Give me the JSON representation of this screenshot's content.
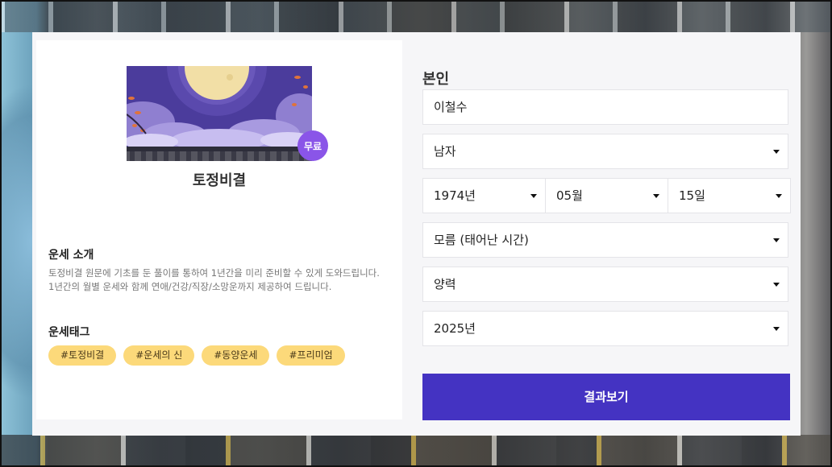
{
  "product": {
    "free_badge": "무료",
    "title": "토정비결"
  },
  "intro": {
    "heading": "운세 소개",
    "line1": "토정비결 원문에 기초를 둔 풀이를 통하여 1년간을 미리 준비할 수 있게 도와드립니다.",
    "line2": "1년간의 월별 운세와 함께 연애/건강/직장/소망운까지 제공하여 드립니다."
  },
  "tags": {
    "heading": "운세태그",
    "items": [
      "#토정비결",
      "#운세의 신",
      "#동양운세",
      "#프리미엄"
    ]
  },
  "form": {
    "section_label": "본인",
    "name_value": "이철수",
    "gender_selected": "남자",
    "birth_year": "1974년",
    "birth_month": "05월",
    "birth_day": "15일",
    "birth_time": "모름 (태어난 시간)",
    "calendar_type": "양력",
    "target_year": "2025년",
    "submit_label": "결과보기"
  },
  "colors": {
    "accent": "#4433c2",
    "badge": "#8a55e8",
    "tag_bg": "#fcd97a"
  }
}
